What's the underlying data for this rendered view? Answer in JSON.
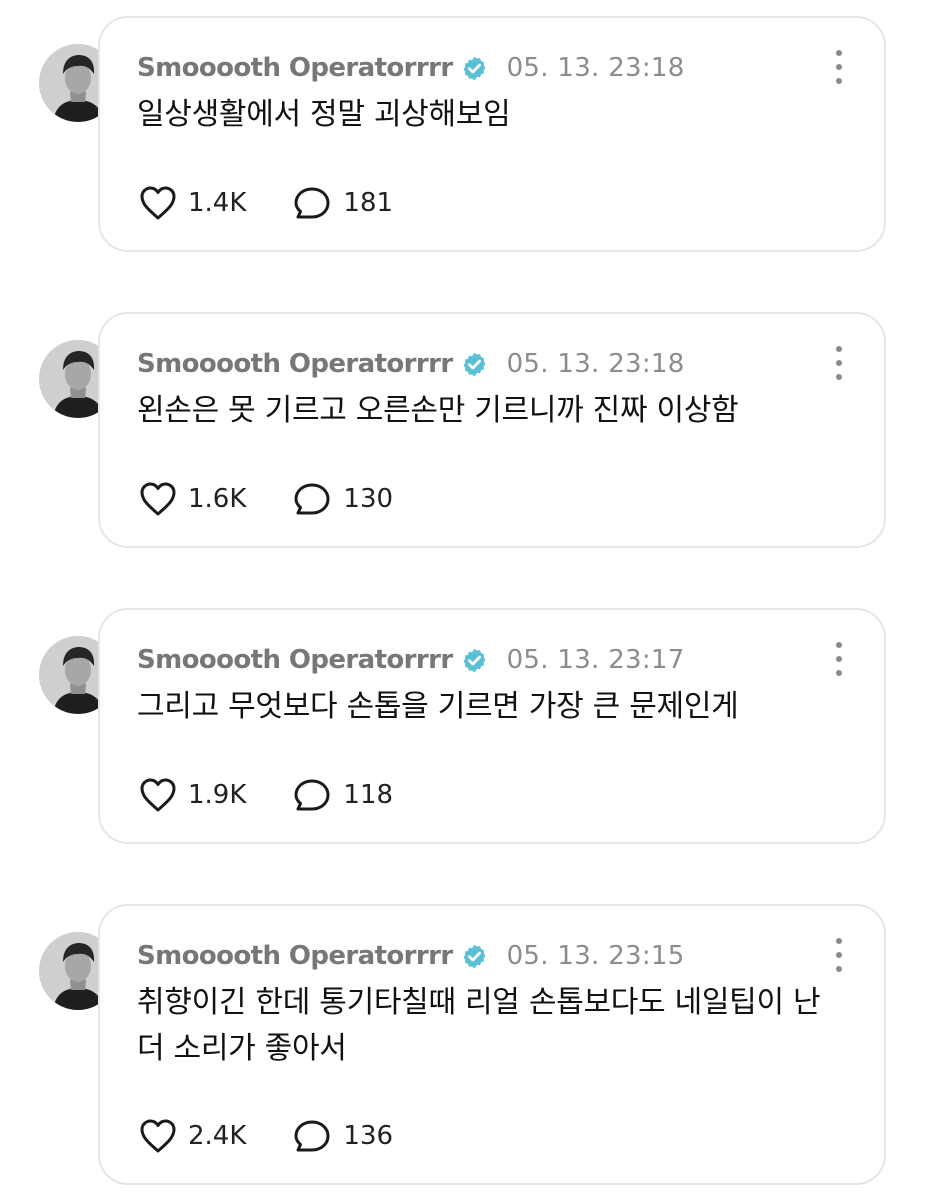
{
  "posts": [
    {
      "author": "Smooooth Operatorrrr",
      "timestamp": "05. 13. 23:18",
      "text": "일상생활에서 정말 괴상해보임",
      "likes": "1.4K",
      "comments": "181"
    },
    {
      "author": "Smooooth Operatorrrr",
      "timestamp": "05. 13. 23:18",
      "text": "왼손은 못 기르고 오른손만 기르니까 진짜 이상함",
      "likes": "1.6K",
      "comments": "130"
    },
    {
      "author": "Smooooth Operatorrrr",
      "timestamp": "05. 13. 23:17",
      "text": "그리고 무엇보다 손톱을 기르면 가장 큰 문제인게",
      "likes": "1.9K",
      "comments": "118"
    },
    {
      "author": "Smooooth Operatorrrr",
      "timestamp": "05. 13. 23:15",
      "text": "취향이긴 한데 통기타칠때 리얼 손톱보다도 네일팁이 난 더 소리가 좋아서",
      "likes": "2.4K",
      "comments": "136"
    }
  ],
  "icons": {
    "verified": "verified-badge-icon",
    "more": "more-vertical-icon",
    "like": "heart-outline-icon",
    "comment": "speech-bubble-icon"
  },
  "colors": {
    "verified_badge": "#5bc0d6",
    "card_border": "#e6e6e6",
    "author": "#777777",
    "timestamp": "#8c8c8c"
  }
}
